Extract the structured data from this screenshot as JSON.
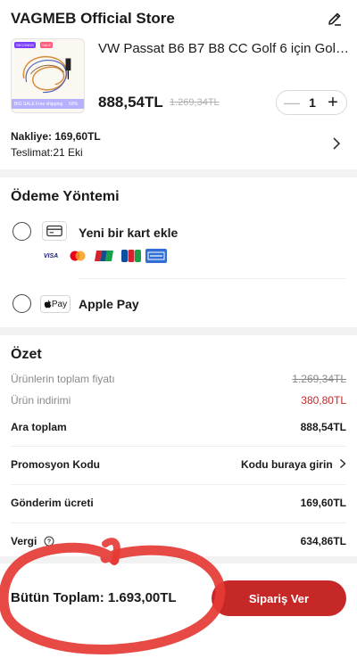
{
  "store": {
    "name": "VAGMEB Official Store",
    "product": {
      "title": "VW Passat B6 B7 B8 CC Golf 6 için Golf 7...",
      "price": "888,54TL",
      "old_price": "1.269,34TL",
      "thumb_tags": {
        "left": "SECONDS",
        "right": "SALE"
      },
      "thumb_strip": {
        "left": "BIG SALE",
        "middle": "Free shipping",
        "right": "50%"
      }
    },
    "quantity": {
      "minus": "—",
      "value": "1",
      "plus": "+"
    },
    "shipping": "Nakliye: 169,60TL",
    "delivery": "Teslimat:21 Eki"
  },
  "payment": {
    "title": "Ödeme Yöntemi",
    "card_option": {
      "label": "Yeni bir kart ekle",
      "brands": [
        "VISA",
        "MC",
        "UnionPay",
        "JCB",
        "AMEX"
      ]
    },
    "apple_option": {
      "badge": "Pay",
      "label": "Apple Pay"
    }
  },
  "summary": {
    "title": "Özet",
    "rows": [
      {
        "label": "Ürünlerin toplam fiyatı",
        "value": "1.269,34TL"
      },
      {
        "label": "Ürün indirimi",
        "value": "380,80TL"
      },
      {
        "label": "Ara toplam",
        "value": "888,54TL"
      }
    ],
    "promo": {
      "label": "Promosyon Kodu",
      "value": "Kodu buraya girin"
    },
    "shipping_fee": {
      "label": "Gönderim ücreti",
      "value": "169,60TL"
    },
    "tax": {
      "label": "Vergi",
      "value": "634,86TL"
    }
  },
  "footer": {
    "total": "Bütün Toplam: 1.693,00TL",
    "order_button": "Sipariş Ver"
  },
  "colors": {
    "accent": "#c62828",
    "annotation": "#e53935"
  }
}
